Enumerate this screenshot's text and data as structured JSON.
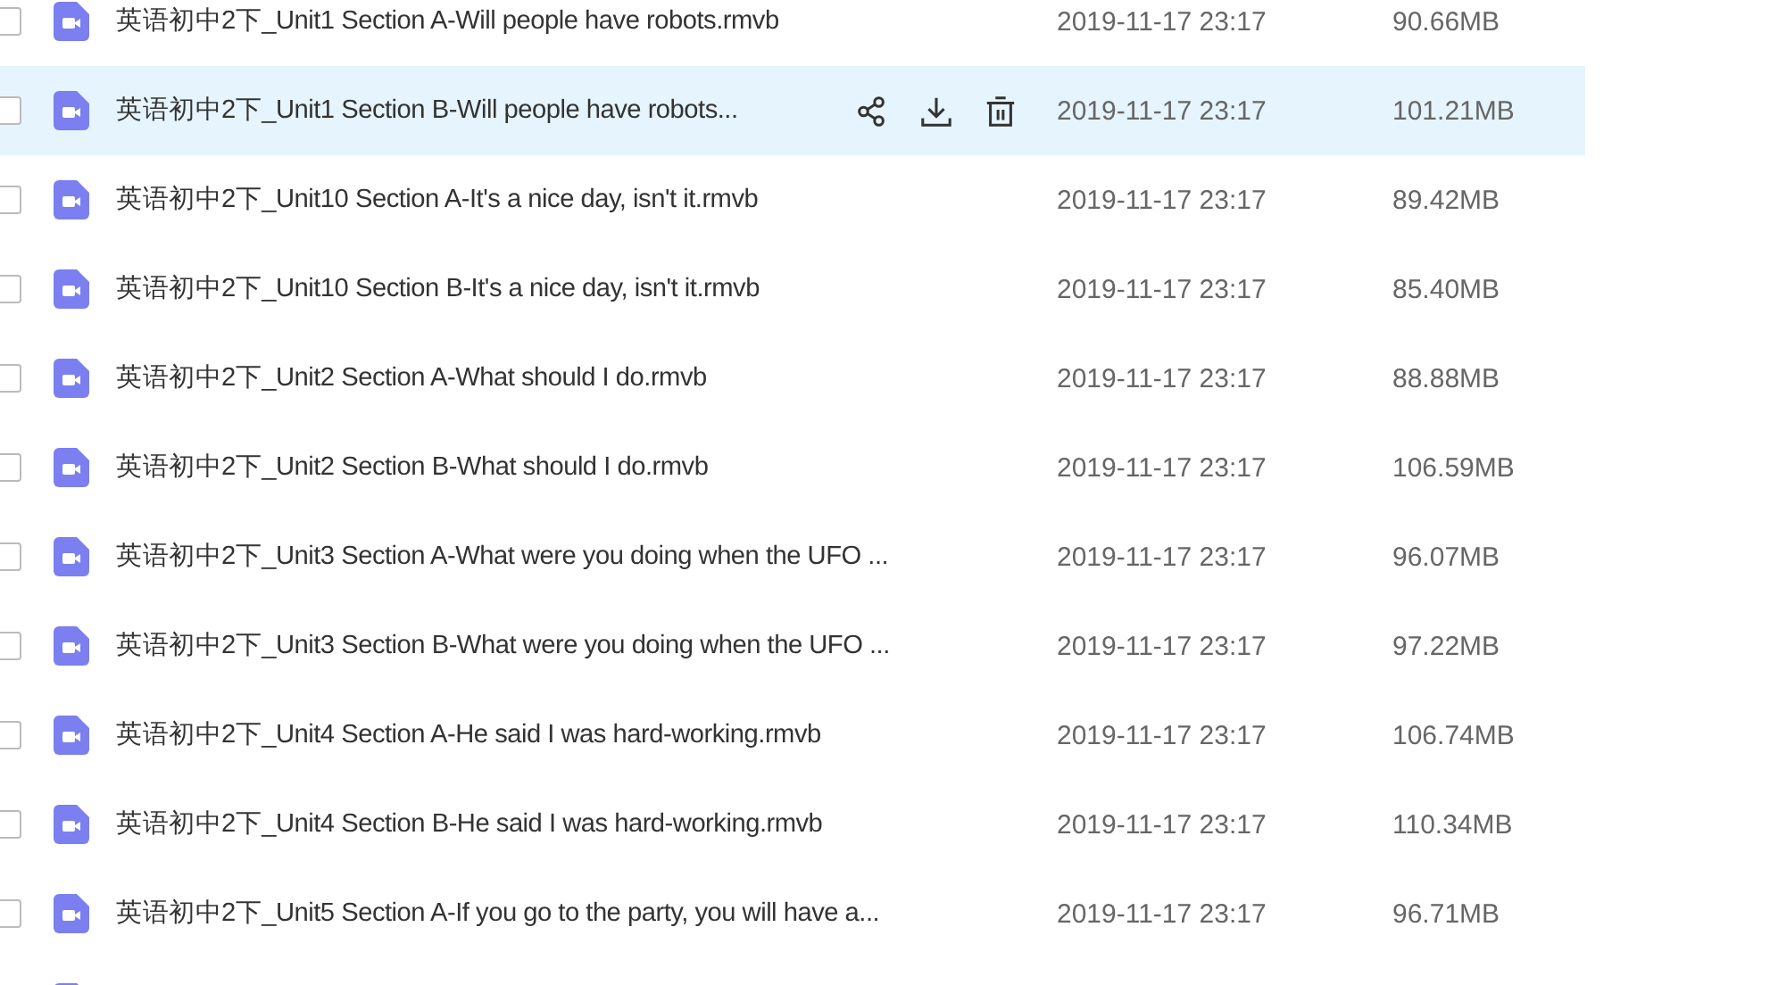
{
  "files": [
    {
      "name": "英语初中2下_Unit1 Section A-Will people have robots.rmvb",
      "date": "2019-11-17 23:17",
      "size": "90.66MB",
      "selected": false
    },
    {
      "name": "英语初中2下_Unit1 Section B-Will people have robots...",
      "date": "2019-11-17 23:17",
      "size": "101.21MB",
      "selected": true
    },
    {
      "name": "英语初中2下_Unit10 Section A-It's a nice day, isn't it.rmvb",
      "date": "2019-11-17 23:17",
      "size": "89.42MB",
      "selected": false
    },
    {
      "name": "英语初中2下_Unit10 Section B-It's a nice day, isn't it.rmvb",
      "date": "2019-11-17 23:17",
      "size": "85.40MB",
      "selected": false
    },
    {
      "name": "英语初中2下_Unit2 Section A-What should I do.rmvb",
      "date": "2019-11-17 23:17",
      "size": "88.88MB",
      "selected": false
    },
    {
      "name": "英语初中2下_Unit2 Section B-What should I do.rmvb",
      "date": "2019-11-17 23:17",
      "size": "106.59MB",
      "selected": false
    },
    {
      "name": "英语初中2下_Unit3 Section A-What were you doing when the UFO ...",
      "date": "2019-11-17 23:17",
      "size": "96.07MB",
      "selected": false
    },
    {
      "name": "英语初中2下_Unit3 Section B-What were you doing when the UFO ...",
      "date": "2019-11-17 23:17",
      "size": "97.22MB",
      "selected": false
    },
    {
      "name": "英语初中2下_Unit4 Section A-He said I was hard-working.rmvb",
      "date": "2019-11-17 23:17",
      "size": "106.74MB",
      "selected": false
    },
    {
      "name": "英语初中2下_Unit4 Section B-He said I was hard-working.rmvb",
      "date": "2019-11-17 23:17",
      "size": "110.34MB",
      "selected": false
    },
    {
      "name": "英语初中2下_Unit5 Section A-If you go to the party, you will have a...",
      "date": "2019-11-17 23:17",
      "size": "96.71MB",
      "selected": false
    }
  ]
}
